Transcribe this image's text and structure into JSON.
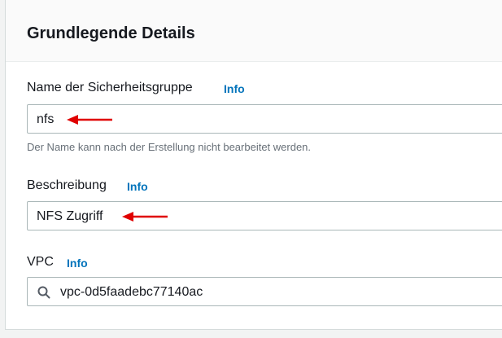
{
  "section": {
    "title": "Grundlegende Details"
  },
  "fields": {
    "name": {
      "label": "Name der Sicherheitsgruppe",
      "info": "Info",
      "value": "nfs",
      "hint": "Der Name kann nach der Erstellung nicht bearbeitet werden."
    },
    "description": {
      "label": "Beschreibung",
      "info": "Info",
      "value": "NFS Zugriff"
    },
    "vpc": {
      "label": "VPC",
      "info": "Info",
      "value": "vpc-0d5faadebc77140ac",
      "icon": "search-icon"
    }
  },
  "annotations": {
    "arrow_color": "#e00000"
  },
  "colors": {
    "link": "#0073bb",
    "text": "#16191f",
    "hint": "#687078",
    "border": "#aab7b8"
  }
}
